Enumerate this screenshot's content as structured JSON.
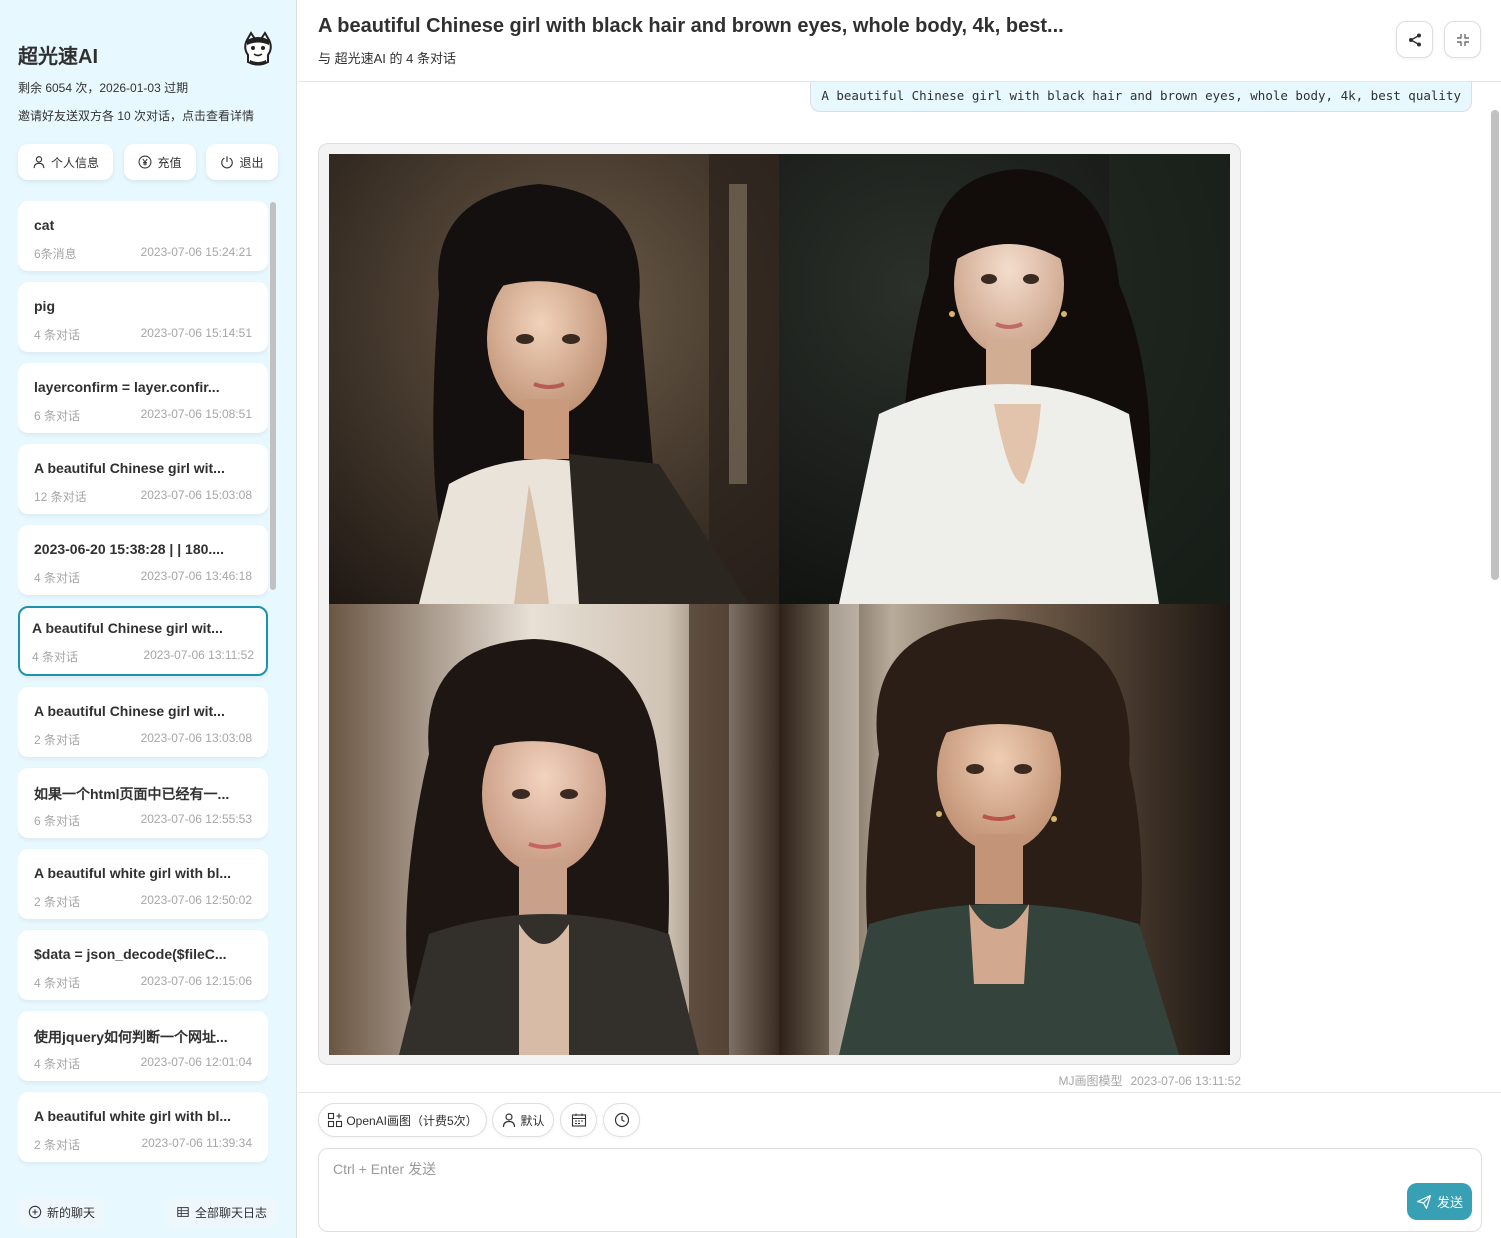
{
  "app": {
    "title": "超光速AI",
    "quota": "剩余 6054 次，2026-01-03 过期",
    "invite": "邀请好友送双方各 10 次对话，点击查看详情",
    "accent": "#1d93ab"
  },
  "sidebar": {
    "actions": [
      {
        "label": "个人信息",
        "icon": "user-icon"
      },
      {
        "label": "充值",
        "icon": "yen-icon"
      },
      {
        "label": "退出",
        "icon": "power-icon"
      }
    ],
    "chats": [
      {
        "title": "cat",
        "count": "6条消息",
        "date": "2023-07-06 15:24:21",
        "selected": false
      },
      {
        "title": "pig",
        "count": "4 条对话",
        "date": "2023-07-06 15:14:51",
        "selected": false
      },
      {
        "title": "layerconfirm = layer.confir...",
        "count": "6 条对话",
        "date": "2023-07-06 15:08:51",
        "selected": false
      },
      {
        "title": "A beautiful Chinese girl wit...",
        "count": "12 条对话",
        "date": "2023-07-06 15:03:08",
        "selected": false
      },
      {
        "title": "2023-06-20 15:38:28 | | 180....",
        "count": "4 条对话",
        "date": "2023-07-06 13:46:18",
        "selected": false
      },
      {
        "title": "A beautiful Chinese girl wit...",
        "count": "4 条对话",
        "date": "2023-07-06 13:11:52",
        "selected": true
      },
      {
        "title": "A beautiful Chinese girl wit...",
        "count": "2 条对话",
        "date": "2023-07-06 13:03:08",
        "selected": false
      },
      {
        "title": "如果一个html页面中已经有一...",
        "count": "6 条对话",
        "date": "2023-07-06 12:55:53",
        "selected": false
      },
      {
        "title": "A beautiful white girl with bl...",
        "count": "2 条对话",
        "date": "2023-07-06 12:50:02",
        "selected": false
      },
      {
        "title": "$data = json_decode($fileC...",
        "count": "4 条对话",
        "date": "2023-07-06 12:15:06",
        "selected": false
      },
      {
        "title": "使用jquery如何判断一个网址...",
        "count": "4 条对话",
        "date": "2023-07-06 12:01:04",
        "selected": false
      },
      {
        "title": "A beautiful white girl with bl...",
        "count": "2 条对话",
        "date": "2023-07-06 11:39:34",
        "selected": false
      }
    ],
    "new_chat": "新的聊天",
    "all_logs": "全部聊天日志"
  },
  "header": {
    "title": "A beautiful Chinese girl with black hair and brown eyes, whole body, 4k, best...",
    "subtitle": "与 超光速AI 的 4 条对话"
  },
  "messages": {
    "user_prompt": "A beautiful Chinese girl with black hair and brown eyes, whole body, 4k, best quality",
    "bot_images": [
      "portrait-1",
      "portrait-2",
      "portrait-3",
      "portrait-4"
    ],
    "bot_model": "MJ画图模型",
    "bot_date": "2023-07-06 13:11:52"
  },
  "input": {
    "chips": [
      {
        "label": "OpenAI画图（计费5次）",
        "icon": "grid-plus-icon"
      },
      {
        "label": "默认",
        "icon": "user-icon"
      },
      {
        "label": "",
        "icon": "calendar-icon"
      },
      {
        "label": "",
        "icon": "clock-icon"
      }
    ],
    "placeholder": "Ctrl + Enter 发送",
    "send_label": "发送"
  }
}
